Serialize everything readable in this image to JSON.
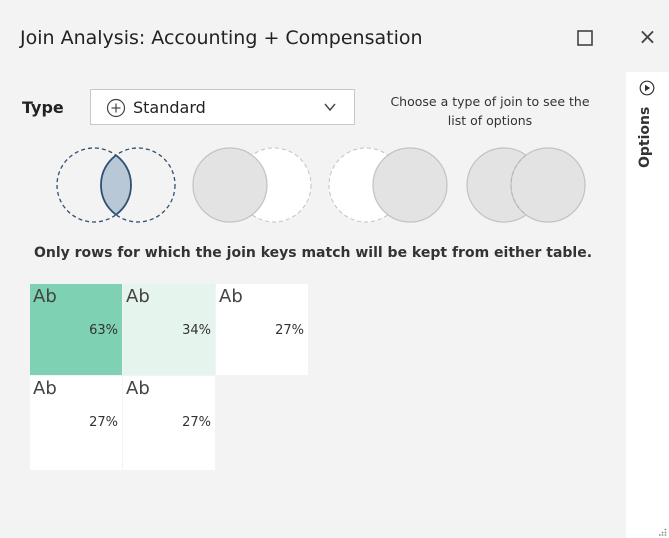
{
  "window": {
    "title": "Join Analysis: Accounting + Compensation",
    "close_label": "×"
  },
  "side_panel": {
    "label": "Options"
  },
  "type": {
    "label": "Type",
    "selected": "Standard",
    "hint": "Choose a type of join to see the list of options"
  },
  "join_types": [
    {
      "icon": "inner-join-venn-icon",
      "selected": true
    },
    {
      "icon": "left-join-venn-icon",
      "selected": false
    },
    {
      "icon": "right-join-venn-icon",
      "selected": false
    },
    {
      "icon": "outer-join-venn-icon",
      "selected": false
    }
  ],
  "description": "Only rows for which the join keys match will be kept from either table.",
  "tiles": [
    {
      "label": "Ab",
      "value": "63%",
      "color": "#7ed1b2"
    },
    {
      "label": "Ab",
      "value": "34%",
      "color": "#e6f4ee"
    },
    {
      "label": "Ab",
      "value": "27%",
      "color": "#ffffff"
    },
    {
      "label": "Ab",
      "value": "27%",
      "color": "#ffffff"
    },
    {
      "label": "Ab",
      "value": "27%",
      "color": "#ffffff"
    }
  ],
  "colors": {
    "accent": "#7ed1b2",
    "selected_venn_fill": "#b9c8d6",
    "selected_venn_stroke": "#2f4f73"
  }
}
